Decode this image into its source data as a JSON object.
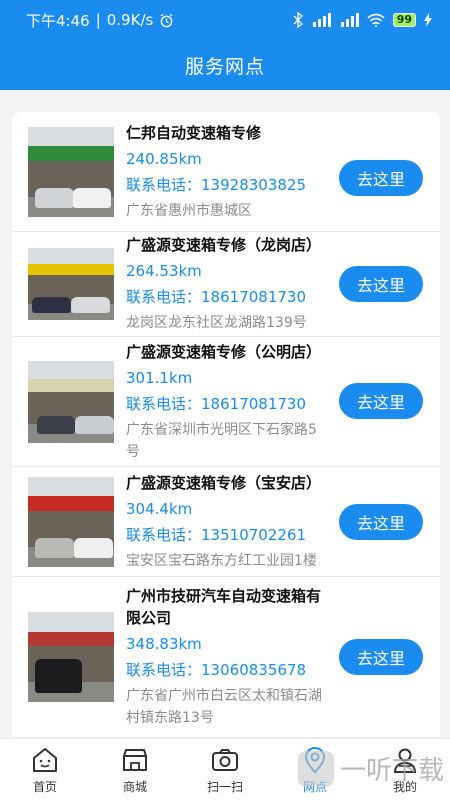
{
  "status_bar": {
    "time": "下午4:46",
    "speed": "0.9K/s",
    "battery": "99"
  },
  "header": {
    "title": "服务网点"
  },
  "stores": [
    {
      "name": "仁邦自动变速箱专修",
      "distance": "240.85km",
      "phone_label": "联系电话：",
      "phone": "13928303825",
      "address": "广东省惠州市惠城区",
      "go_label": "去这里",
      "sign_color": "#2f8a3c"
    },
    {
      "name": "广盛源变速箱专修（龙岗店）",
      "distance": "264.53km",
      "phone_label": "联系电话：",
      "phone": "18617081730",
      "address": "龙岗区龙东社区龙湖路139号",
      "go_label": "去这里",
      "sign_color": "#e4c400"
    },
    {
      "name": "广盛源变速箱专修（公明店）",
      "distance": "301.1km",
      "phone_label": "联系电话：",
      "phone": "18617081730",
      "address": "广东省深圳市光明区下石家路5号",
      "go_label": "去这里",
      "sign_color": "#d9d2b0"
    },
    {
      "name": "广盛源变速箱专修（宝安店）",
      "distance": "304.4km",
      "phone_label": "联系电话：",
      "phone": "13510702261",
      "address": "宝安区宝石路东方红工业园1楼",
      "go_label": "去这里",
      "sign_color": "#c62b22"
    },
    {
      "name": "广州市技研汽车自动变速箱有限公司",
      "distance": "348.83km",
      "phone_label": "联系电话：",
      "phone": "13060835678",
      "address": "广东省广州市白云区太和镇石湖村镇东路13号",
      "go_label": "去这里",
      "sign_color": "#b33a30"
    }
  ],
  "tabs": [
    {
      "label": "首页",
      "icon": "home-icon"
    },
    {
      "label": "商城",
      "icon": "store-icon"
    },
    {
      "label": "扫一扫",
      "icon": "camera-icon"
    },
    {
      "label": "网点",
      "icon": "location-pin-icon"
    },
    {
      "label": "我的",
      "icon": "user-icon"
    }
  ],
  "watermark": {
    "text": "一听下载"
  },
  "colors": {
    "primary": "#1a8cf0",
    "background": "#f3f4f6",
    "address_gray": "#8c8c8c"
  }
}
